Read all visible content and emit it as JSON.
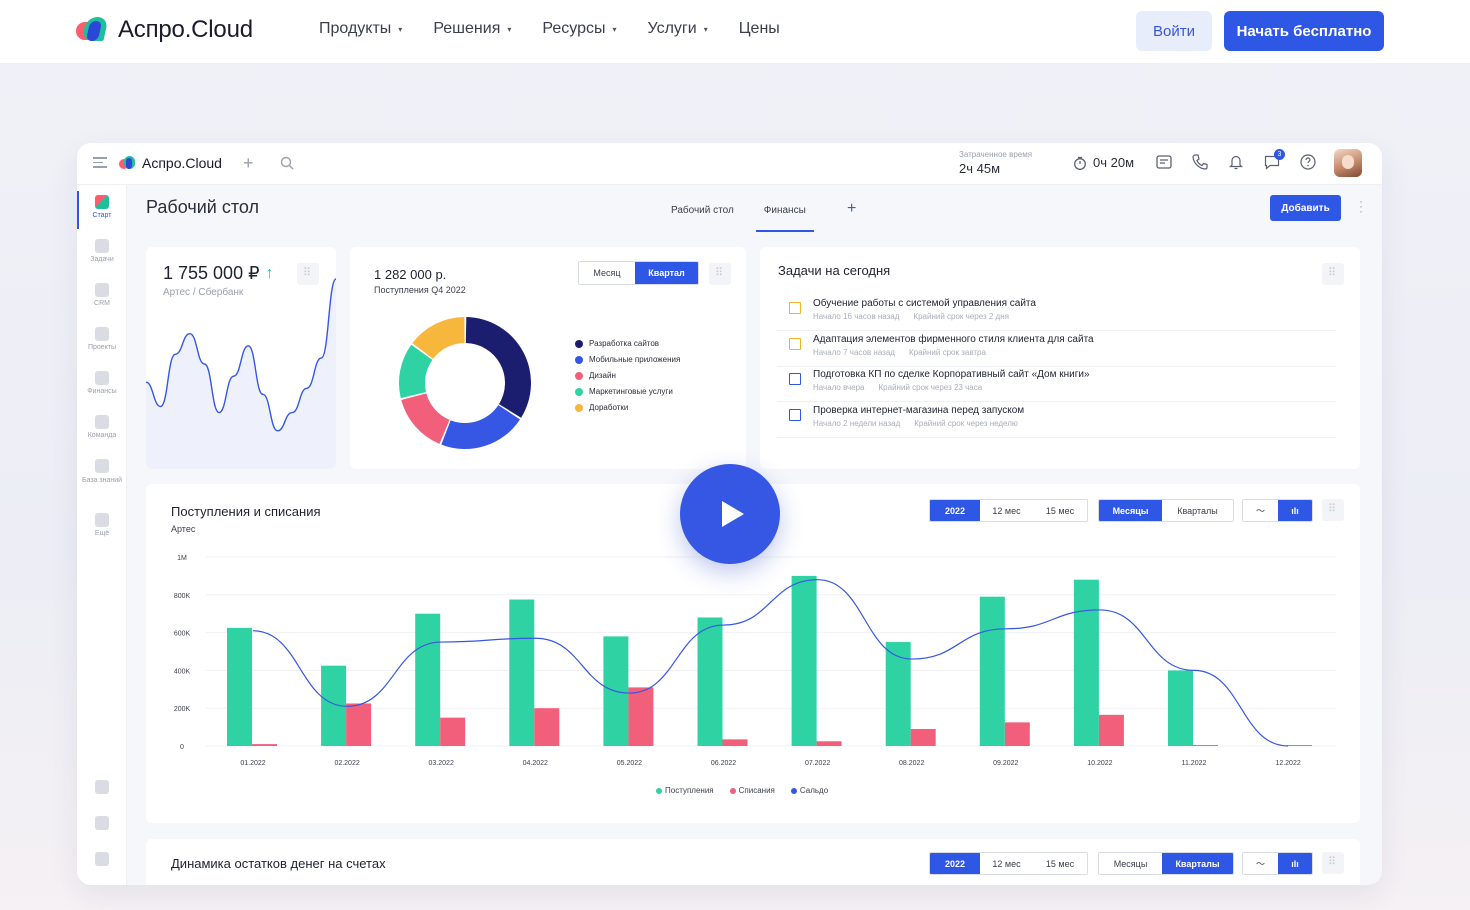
{
  "site": {
    "brand": "Аспро.Cloud",
    "nav": [
      {
        "label": "Продукты",
        "has_caret": true
      },
      {
        "label": "Решения",
        "has_caret": true
      },
      {
        "label": "Ресурсы",
        "has_caret": true
      },
      {
        "label": "Услуги",
        "has_caret": true
      },
      {
        "label": "Цены",
        "has_caret": false
      }
    ],
    "login_label": "Войти",
    "start_label": "Начать бесплатно",
    "caret": "▾"
  },
  "app": {
    "brand": "Аспро.Cloud",
    "time_spent_label": "Затраченное время",
    "time_spent_value": "2ч 45м",
    "timer_value": "0ч 20м",
    "chat_badge": "3",
    "sidebar": [
      {
        "label": "Старт",
        "active": true
      },
      {
        "label": "Задачи"
      },
      {
        "label": "CRM"
      },
      {
        "label": "Проекты"
      },
      {
        "label": "Финансы"
      },
      {
        "label": "Команда"
      },
      {
        "label": "База знаний"
      },
      {
        "label": "Ещё"
      }
    ],
    "page_title": "Рабочий стол",
    "tabs": [
      {
        "label": "Рабочий стол",
        "active": false
      },
      {
        "label": "Финансы",
        "active": true
      }
    ],
    "add_label": "Добавить",
    "balance": {
      "value": "1 755 000 ₽",
      "arrow": "↑",
      "sub": "Артес / Сбербанк"
    },
    "income": {
      "value": "1 282 000 р.",
      "sub": "Поступления Q4 2022",
      "period_buttons": [
        "Месяц",
        "Квартал"
      ],
      "active_period": "Квартал",
      "legend": [
        {
          "label": "Разработка сайтов",
          "color": "#1b1e6e"
        },
        {
          "label": "Мобильные приложения",
          "color": "#3557e3"
        },
        {
          "label": "Дизайн",
          "color": "#f25f7a"
        },
        {
          "label": "Маркетинговые услуги",
          "color": "#2fd3a3"
        },
        {
          "label": "Доработки",
          "color": "#f6b73c"
        }
      ]
    },
    "tasks": {
      "title": "Задачи на сегодня",
      "items": [
        {
          "title": "Обучение работы с системой управления сайта",
          "started": "Начало 16 часов назад",
          "deadline": "Крайний срок через 2 дня",
          "color": "yellow"
        },
        {
          "title": "Адаптация элементов фирменного стиля клиента для сайта",
          "started": "Начало 7 часов назад",
          "deadline": "Крайний срок завтра",
          "color": "yellow"
        },
        {
          "title": "Подготовка КП по сделке Корпоративный сайт «Дом книги»",
          "started": "Начало вчера",
          "deadline": "Крайний срок через 23 часа",
          "color": "blue"
        },
        {
          "title": "Проверка интернет-магазина перед запуском",
          "started": "Начало 2 недели назад",
          "deadline": "Крайний срок через неделю",
          "color": "blue"
        }
      ]
    },
    "flow": {
      "title": "Поступления и списания",
      "sub": "Артес",
      "year_buttons": [
        "2022",
        "12 мес",
        "15 мес"
      ],
      "mode_buttons": [
        "Месяцы",
        "Кварталы"
      ]
    },
    "balances": {
      "title": "Динамика остатков денег на счетах",
      "year_buttons": [
        "2022",
        "12 мес",
        "15 мес"
      ],
      "mode_buttons": [
        "Месяцы",
        "Кварталы"
      ]
    }
  },
  "chart_data": [
    {
      "type": "line",
      "title": "",
      "note": "balance sparkline (no axes)",
      "values": [
        0.55,
        0.35,
        0.78,
        0.95,
        0.7,
        0.3,
        0.6,
        0.85,
        0.45,
        0.15,
        0.3,
        0.5,
        0.75,
        1.4
      ]
    },
    {
      "type": "pie",
      "title": "Поступления Q4 2022",
      "categories": [
        "Разработка сайтов",
        "Мобильные приложения",
        "Дизайн",
        "Маркетинговые услуги",
        "Доработки"
      ],
      "values": [
        34,
        22,
        15,
        14,
        15
      ]
    },
    {
      "type": "bar",
      "title": "Поступления и списания",
      "categories": [
        "01.2022",
        "02.2022",
        "03.2022",
        "04.2022",
        "05.2022",
        "06.2022",
        "07.2022",
        "08.2022",
        "09.2022",
        "10.2022",
        "11.2022",
        "12.2022"
      ],
      "y_ticks": [
        "0",
        "200K",
        "400K",
        "600K",
        "800K",
        "1M"
      ],
      "ylim": [
        0,
        1000000
      ],
      "series": [
        {
          "name": "Поступления",
          "color": "#2fd3a3",
          "values": [
            625000,
            425000,
            700000,
            775000,
            580000,
            680000,
            900000,
            550000,
            790000,
            880000,
            400000,
            0
          ]
        },
        {
          "name": "Списания",
          "color": "#f25f7a",
          "values": [
            10000,
            225000,
            150000,
            200000,
            310000,
            35000,
            25000,
            90000,
            125000,
            165000,
            5000,
            5000
          ]
        },
        {
          "name": "Сальдо",
          "color": "#3557e3",
          "values": [
            610000,
            210000,
            550000,
            570000,
            280000,
            640000,
            880000,
            460000,
            620000,
            720000,
            400000,
            0
          ]
        }
      ]
    }
  ]
}
